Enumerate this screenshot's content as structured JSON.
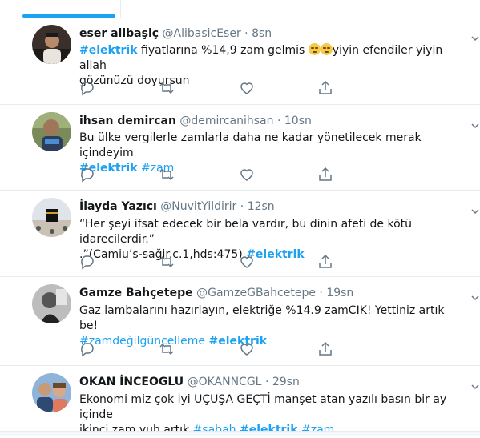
{
  "tweets": [
    {
      "name": "eser alibaşiç",
      "handle": "@AlibasicEser",
      "dot": "·",
      "time": "8sn",
      "text": {
        "tag1": "#elektrik",
        "t1": " fiyatlarına %14,9 zam gelmis ",
        "t2": "yiyin efendiler yiyin allah",
        "t3": "gözünüzü doyursun"
      }
    },
    {
      "name": "ihsan demircan",
      "handle": "@demircanihsan",
      "dot": "·",
      "time": "10sn",
      "text": {
        "t1": "Bu ülke vergilerle zamlarla daha ne kadar yönetilecek merak içindeyim",
        "tag1": "#elektrik",
        "tag2": "#zam"
      }
    },
    {
      "name": "İlayda Yazıcı",
      "handle": "@NuvitYildirir",
      "dot": "·",
      "time": "12sn",
      "text": {
        "t1": "“Her şeyi ifsat edecek bir bela vardır, bu dinin afeti de kötü idarecilerdir.”",
        "t2": ".”(Camiu’s-sağir.c.1,hds:475)",
        "tag1": "#elektrik"
      }
    },
    {
      "name": "Gamze Bahçetepe",
      "handle": "@GamzeGBahcetepe",
      "dot": "·",
      "time": "19sn",
      "text": {
        "t1": "Gaz lambalarını hazırlayın, elektriğe %14.9 zamCIK! Yettiniz artık be!",
        "tag1": "#zamdeğilgüncelleme",
        "tag2": "#elektrik"
      }
    },
    {
      "name": "OKAN İNCEOGLU",
      "handle": "@OKANNCGL",
      "dot": "·",
      "time": "29sn",
      "text": {
        "t1": "Ekonomi miz çok iyi UÇUŞA GEÇTİ manşet atan yazılı basın bir ay içinde",
        "t2": "ikinci zam yuh artık",
        "tag1": "#sabah",
        "tag2": "#elektrik",
        "tag3": "#zam"
      }
    }
  ],
  "icons": [
    "reply-icon",
    "retweet-icon",
    "like-icon",
    "share-icon",
    "chevron-down-icon"
  ],
  "colors": {
    "accent": "#1da1f2",
    "text": "#14171a",
    "muted": "#657786",
    "border": "#e6ecf0"
  }
}
